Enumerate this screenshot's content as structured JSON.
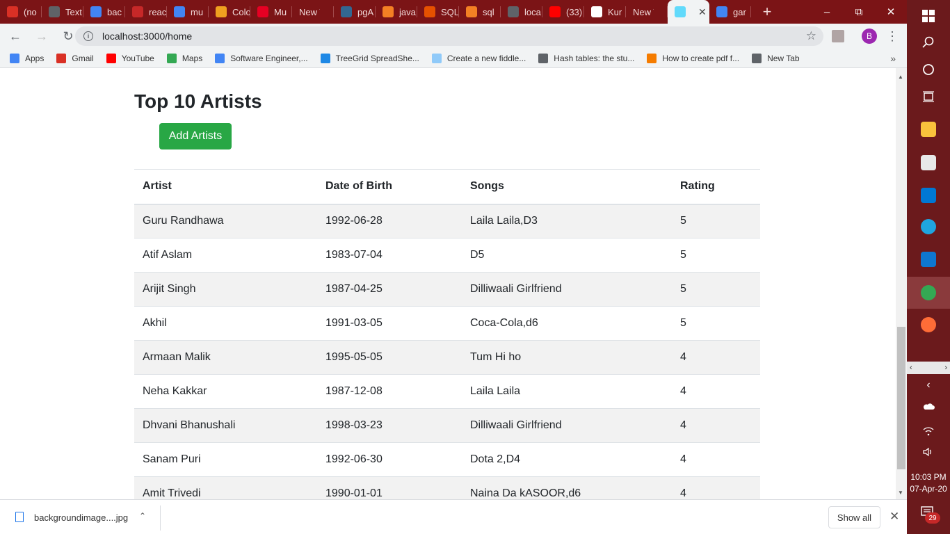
{
  "tabs": [
    {
      "label": "(no",
      "favicon_color": "#d93025",
      "favicon": "gmail-icon"
    },
    {
      "label": "Text",
      "favicon_color": "#5f6368",
      "favicon": "edit-icon"
    },
    {
      "label": "bac",
      "favicon_color": "#4285f4",
      "favicon": "google-icon"
    },
    {
      "label": "reac",
      "favicon_color": "#c62828",
      "favicon": "page-icon"
    },
    {
      "label": "mu",
      "favicon_color": "#4285f4",
      "favicon": "google-icon"
    },
    {
      "label": "Colo",
      "favicon_color": "#f0a020",
      "favicon": "diamond-icon"
    },
    {
      "label": "Mu",
      "favicon_color": "#e60023",
      "favicon": "pinterest-icon"
    },
    {
      "label": "New Tab",
      "favicon_color": "",
      "favicon": ""
    },
    {
      "label": "pgA",
      "favicon_color": "#336791",
      "favicon": "pg-icon"
    },
    {
      "label": "java",
      "favicon_color": "#f48024",
      "favicon": "stackoverflow-icon"
    },
    {
      "label": "SQL",
      "favicon_color": "#e65100",
      "favicon": "sql-icon"
    },
    {
      "label": "sql",
      "favicon_color": "#f48024",
      "favicon": "stackoverflow-icon"
    },
    {
      "label": "loca",
      "favicon_color": "#5f6368",
      "favicon": "react-icon"
    },
    {
      "label": "(33)",
      "favicon_color": "#ff0000",
      "favicon": "youtube-icon"
    },
    {
      "label": "Kur",
      "favicon_color": "#ffffff",
      "favicon": "wikipedia-icon"
    },
    {
      "label": "New Tab",
      "favicon_color": "",
      "favicon": ""
    },
    {
      "label": "",
      "favicon_color": "#61dafb",
      "favicon": "react-icon",
      "active": true
    },
    {
      "label": "gar",
      "favicon_color": "#4285f4",
      "favicon": "google-icon"
    }
  ],
  "window": {
    "minimize": "–",
    "restore": "⧉",
    "close": "✕",
    "new_tab": "+",
    "tab_close": "✕"
  },
  "toolbar": {
    "back": "←",
    "forward": "→",
    "reload": "↻",
    "info": "i",
    "url": "localhost:3000/home",
    "star": "☆",
    "profile_initial": "B",
    "menu": "⋮"
  },
  "bookmarks": [
    {
      "label": "Apps",
      "color": "#4285f4"
    },
    {
      "label": "Gmail",
      "color": "#d93025"
    },
    {
      "label": "YouTube",
      "color": "#ff0000"
    },
    {
      "label": "Maps",
      "color": "#34a853"
    },
    {
      "label": "Software Engineer,...",
      "color": "#4285f4"
    },
    {
      "label": "TreeGrid SpreadShe...",
      "color": "#1e88e5"
    },
    {
      "label": "Create a new fiddle...",
      "color": "#90caf9"
    },
    {
      "label": "Hash tables: the stu...",
      "color": "#5f6368"
    },
    {
      "label": "How to create pdf f...",
      "color": "#f57c00"
    },
    {
      "label": "New Tab",
      "color": "#5f6368"
    }
  ],
  "bookmarks_more": "»",
  "page": {
    "title": "Top 10 Artists",
    "add_button": "Add Artists",
    "columns": [
      "Artist",
      "Date of Birth",
      "Songs",
      "Rating"
    ],
    "rows": [
      [
        "Guru Randhawa",
        "1992-06-28",
        "Laila Laila,D3",
        "5"
      ],
      [
        "Atif Aslam",
        "1983-07-04",
        "D5",
        "5"
      ],
      [
        "Arijit Singh",
        "1987-04-25",
        "Dilliwaali Girlfriend",
        "5"
      ],
      [
        "Akhil",
        "1991-03-05",
        "Coca-Cola,d6",
        "5"
      ],
      [
        "Armaan Malik",
        "1995-05-05",
        "Tum Hi ho",
        "4"
      ],
      [
        "Neha Kakkar",
        "1987-12-08",
        "Laila Laila",
        "4"
      ],
      [
        "Dhvani Bhanushali",
        "1998-03-23",
        "Dilliwaali Girlfriend",
        "4"
      ],
      [
        "Sanam Puri",
        "1992-06-30",
        "Dota 2,D4",
        "4"
      ],
      [
        "Amit Trivedi",
        "1990-01-01",
        "Naina Da kASOOR,d6",
        "4"
      ]
    ]
  },
  "downloads": {
    "filename": "backgroundimage....jpg",
    "caret": "⌃",
    "show_all": "Show all",
    "close": "✕"
  },
  "taskbar": {
    "time": "10:03 PM",
    "date": "07-Apr-20",
    "notifications": "29",
    "apps": [
      {
        "name": "file-explorer",
        "color": "#f9c23c"
      },
      {
        "name": "store",
        "color": "#e8e8e8"
      },
      {
        "name": "mail",
        "color": "#0078d4"
      },
      {
        "name": "edge",
        "color": "#1fa5e0"
      },
      {
        "name": "vscode",
        "color": "#0e77d0"
      },
      {
        "name": "chrome",
        "color": "#34a853"
      },
      {
        "name": "postman",
        "color": "#ff6c37"
      }
    ]
  }
}
